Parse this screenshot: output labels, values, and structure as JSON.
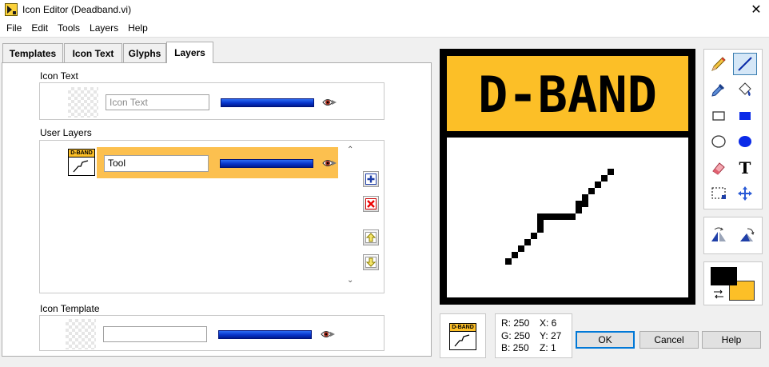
{
  "window": {
    "title": "Icon Editor (Deadband.vi)"
  },
  "menu": [
    "File",
    "Edit",
    "Tools",
    "Layers",
    "Help"
  ],
  "tabs": [
    "Templates",
    "Icon Text",
    "Glyphs",
    "Layers"
  ],
  "active_tab": "Layers",
  "layers": {
    "icon_text": {
      "label": "Icon Text",
      "value": "Icon Text"
    },
    "user_layers": {
      "label": "User Layers",
      "items": [
        {
          "name": "Tool",
          "icon_text": "D-BAND"
        }
      ]
    },
    "icon_template": {
      "label": "Icon Template",
      "value": ""
    }
  },
  "canvas": {
    "banner_text": "D-BAND",
    "banner_color": "#fcbf27"
  },
  "tools": [
    "pencil-icon",
    "line-icon",
    "dropper-icon",
    "fill-icon",
    "rectangle-icon",
    "filled-rectangle-icon",
    "ellipse-icon",
    "filled-ellipse-icon",
    "eraser-icon",
    "text-icon",
    "select-icon",
    "move-icon"
  ],
  "colors": {
    "foreground": "#000000",
    "background": "#fcbf27",
    "accent": "#0078d7"
  },
  "readout": {
    "r": "R: 250",
    "g": "G: 250",
    "b": "B: 250",
    "x": "X: 6",
    "y": "Y: 27",
    "z": "Z: 1"
  },
  "preview": {
    "banner_text": "D-BAND"
  },
  "buttons": {
    "ok": "OK",
    "cancel": "Cancel",
    "help": "Help"
  }
}
